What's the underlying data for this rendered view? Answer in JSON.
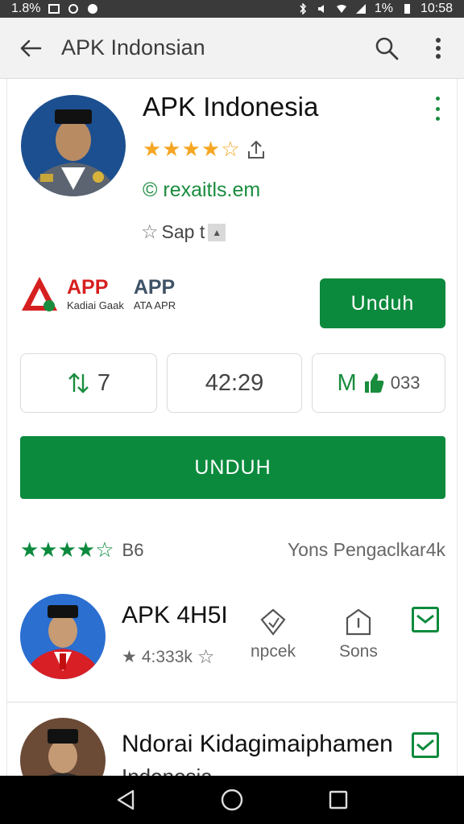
{
  "status_bar": {
    "left_text": "1.8%",
    "time": "10:58",
    "battery_text": "1%"
  },
  "toolbar": {
    "title": "APK Indonsian"
  },
  "app": {
    "name": "APK Indonesia",
    "rating_stars": 3.5,
    "developer_link": "rexaitls.em",
    "developer_prefix": "©",
    "badge_text": "Sap t"
  },
  "brand": {
    "word1": "APP",
    "word1_sub": "Kadiai Gaak",
    "word2": "APP",
    "word2_sub": "ATA APR"
  },
  "buttons": {
    "install_small": "Unduh",
    "install_big": "UNDUH"
  },
  "stats": [
    {
      "value": "7",
      "extra": ""
    },
    {
      "value": "42:29",
      "extra": ""
    },
    {
      "value": "M",
      "extra": "033"
    }
  ],
  "summary": {
    "stars": 4.5,
    "count": "B6",
    "right_text": "Yons Pengaclkar4k"
  },
  "list": [
    {
      "title": "APK 4H5I",
      "meta": "4:333k",
      "action1_label": "npcek",
      "action2_label": "Sons"
    },
    {
      "title": "Ndorai Kidagimaiphamen",
      "subtitle": "Indonesia"
    }
  ],
  "colors": {
    "accent_green": "#0b8a3d",
    "star_gold": "#f5a623",
    "brand_red": "#d62020"
  }
}
